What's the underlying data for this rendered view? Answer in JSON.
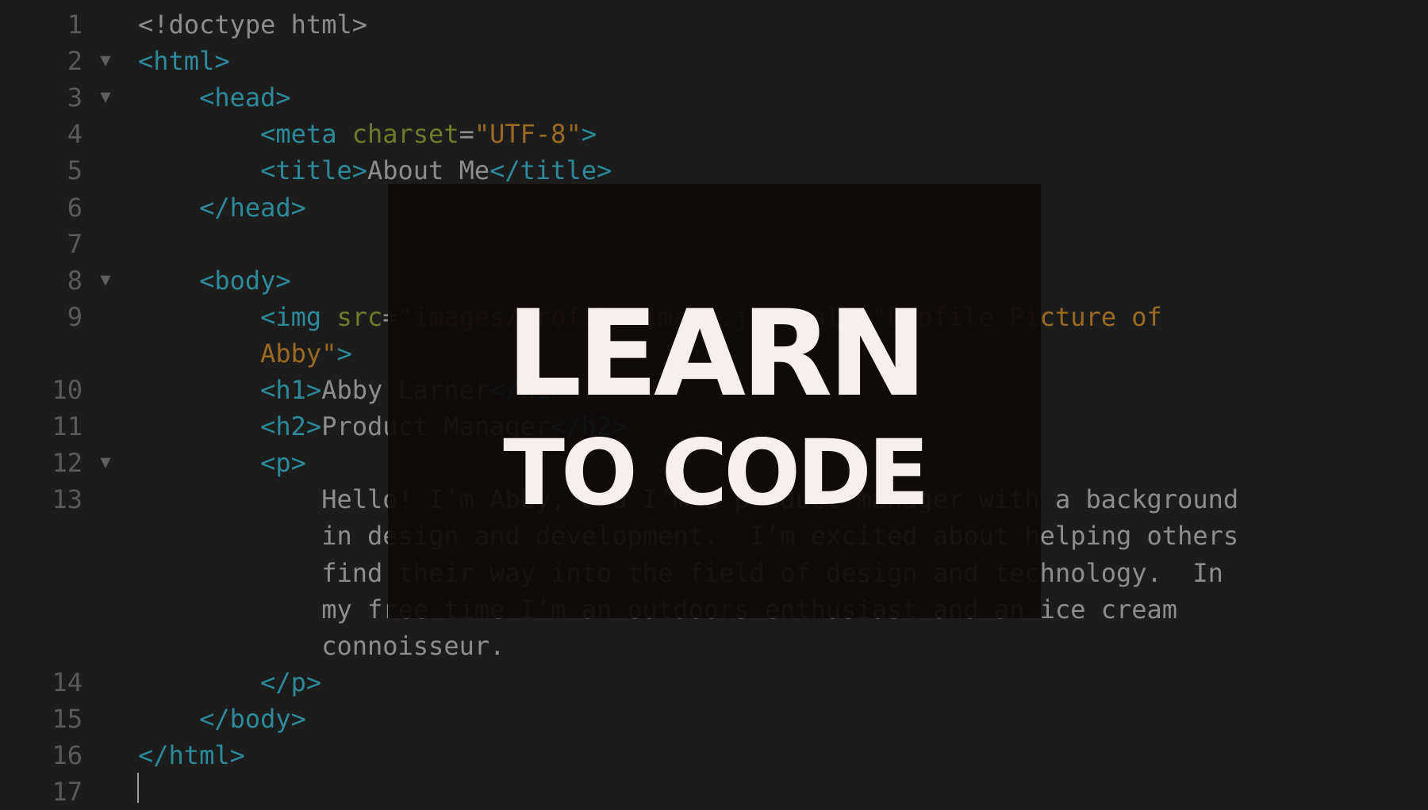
{
  "editor": {
    "lines": [
      {
        "num": "1",
        "fold": "",
        "indent": "",
        "tokens": [
          [
            "plain",
            "<!doctype html>"
          ]
        ]
      },
      {
        "num": "2",
        "fold": "▼",
        "indent": "",
        "tokens": [
          [
            "tag",
            "<html>"
          ]
        ]
      },
      {
        "num": "3",
        "fold": "▼",
        "indent": "    ",
        "tokens": [
          [
            "tag",
            "<head>"
          ]
        ]
      },
      {
        "num": "4",
        "fold": "",
        "indent": "        ",
        "tokens": [
          [
            "tag",
            "<meta "
          ],
          [
            "attr",
            "charset"
          ],
          [
            "plain",
            "="
          ],
          [
            "str",
            "\"UTF-8\""
          ],
          [
            "tag",
            ">"
          ]
        ]
      },
      {
        "num": "5",
        "fold": "",
        "indent": "        ",
        "tokens": [
          [
            "tag",
            "<title>"
          ],
          [
            "text",
            "About Me"
          ],
          [
            "tag",
            "</title>"
          ]
        ]
      },
      {
        "num": "6",
        "fold": "",
        "indent": "    ",
        "tokens": [
          [
            "tag",
            "</head>"
          ]
        ]
      },
      {
        "num": "7",
        "fold": "",
        "indent": "",
        "tokens": []
      },
      {
        "num": "8",
        "fold": "▼",
        "indent": "    ",
        "tokens": [
          [
            "tag",
            "<body>"
          ]
        ]
      },
      {
        "num": "9",
        "fold": "",
        "indent": "        ",
        "tokens": [
          [
            "tag",
            "<img "
          ],
          [
            "attr",
            "src"
          ],
          [
            "plain",
            "="
          ],
          [
            "str",
            "\"images/profile-image.jpg\" "
          ],
          [
            "attr",
            "alt"
          ],
          [
            "plain",
            "="
          ],
          [
            "str",
            "\"Profile Picture of"
          ]
        ]
      },
      {
        "num": "",
        "fold": "",
        "indent": "        ",
        "tokens": [
          [
            "str",
            "Abby\""
          ],
          [
            "tag",
            ">"
          ]
        ]
      },
      {
        "num": "10",
        "fold": "",
        "indent": "        ",
        "tokens": [
          [
            "tag",
            "<h1>"
          ],
          [
            "text",
            "Abby Larner"
          ],
          [
            "tag",
            "</h1>"
          ]
        ]
      },
      {
        "num": "11",
        "fold": "",
        "indent": "        ",
        "tokens": [
          [
            "tag",
            "<h2>"
          ],
          [
            "text",
            "Product Manager"
          ],
          [
            "tag",
            "</h2>"
          ]
        ]
      },
      {
        "num": "12",
        "fold": "▼",
        "indent": "        ",
        "tokens": [
          [
            "tag",
            "<p>"
          ]
        ]
      },
      {
        "num": "13",
        "fold": "",
        "indent": "            ",
        "tokens": [
          [
            "text",
            "Hello! I’m Abby, and I’m a product manager with a background"
          ]
        ]
      },
      {
        "num": "",
        "fold": "",
        "indent": "            ",
        "tokens": [
          [
            "text",
            "in design and development.  I’m excited about helping others"
          ]
        ]
      },
      {
        "num": "",
        "fold": "",
        "indent": "            ",
        "tokens": [
          [
            "text",
            "find their way into the field of design and technology.  In"
          ]
        ]
      },
      {
        "num": "",
        "fold": "",
        "indent": "            ",
        "tokens": [
          [
            "text",
            "my free time I’m an outdoors enthusiast and an ice cream"
          ]
        ]
      },
      {
        "num": "",
        "fold": "",
        "indent": "            ",
        "tokens": [
          [
            "text",
            "connoisseur."
          ]
        ]
      },
      {
        "num": "14",
        "fold": "",
        "indent": "        ",
        "tokens": [
          [
            "tag",
            "</p>"
          ]
        ]
      },
      {
        "num": "15",
        "fold": "",
        "indent": "    ",
        "tokens": [
          [
            "tag",
            "</body>"
          ]
        ]
      },
      {
        "num": "16",
        "fold": "",
        "indent": "",
        "tokens": [
          [
            "tag",
            "</html>"
          ]
        ]
      },
      {
        "num": "17",
        "fold": "",
        "indent": "",
        "tokens": []
      }
    ]
  },
  "overlay": {
    "line1": "LEARN",
    "line2": "TO CODE"
  }
}
